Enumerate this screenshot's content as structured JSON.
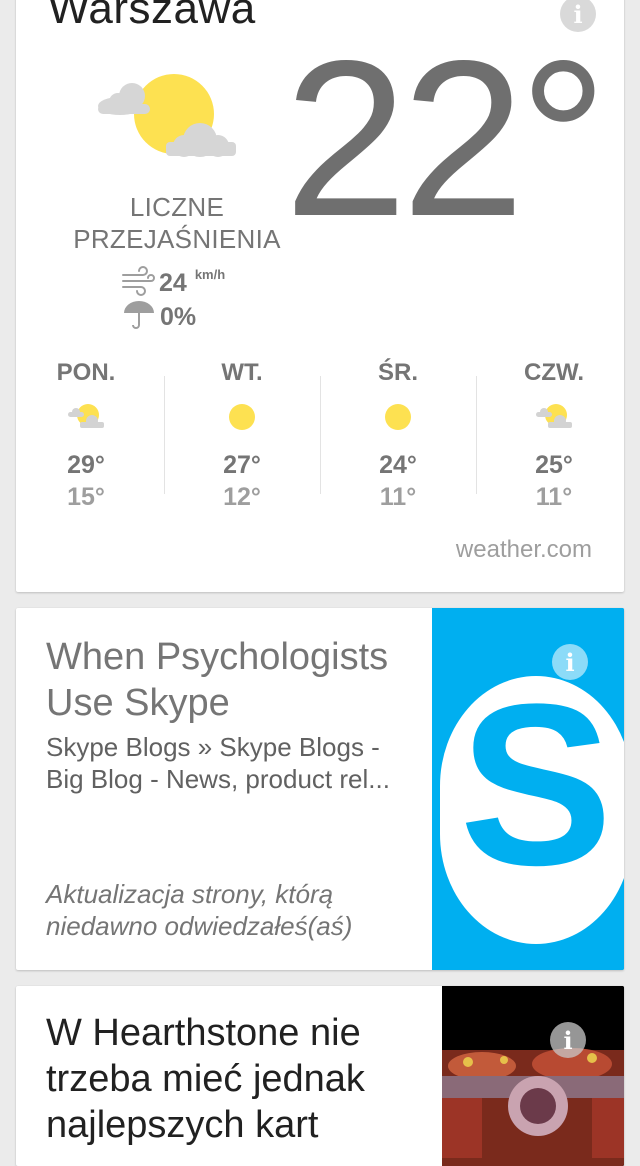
{
  "weather": {
    "city": "Warszawa",
    "condition_line1": "LICZNE",
    "condition_line2": "PRZEJAŚNIENIA",
    "condition_icon": "partly-cloudy-icon",
    "temperature": "22°",
    "wind_speed": "24",
    "wind_unit": "km/h",
    "precipitation": "0%",
    "source": "weather.com",
    "forecast": [
      {
        "day": "PON.",
        "icon": "partly-cloudy-icon",
        "high": "29°",
        "low": "15°"
      },
      {
        "day": "WT.",
        "icon": "sun-icon",
        "high": "27°",
        "low": "12°"
      },
      {
        "day": "ŚR.",
        "icon": "sun-icon",
        "high": "24°",
        "low": "11°"
      },
      {
        "day": "CZW.",
        "icon": "partly-cloudy-icon",
        "high": "25°",
        "low": "11°"
      }
    ]
  },
  "cards": [
    {
      "title": "When Psychologists Use Skype",
      "source": "Skype Blogs » Skype Blogs - Big Blog - News, product rel...",
      "footer": "Aktualizacja strony, którą niedawno odwiedzałeś(aś)",
      "thumbnail": "skype-logo"
    },
    {
      "title": "W Hearthstone nie trzeba mieć jednak najlepszych kart",
      "thumbnail": "hearthstone-image"
    }
  ],
  "icons": {
    "info": "i"
  },
  "colors": {
    "background": "#ebebeb",
    "sun": "#fde151",
    "skype_blue": "#00aff0",
    "text_gray": "#757575"
  }
}
